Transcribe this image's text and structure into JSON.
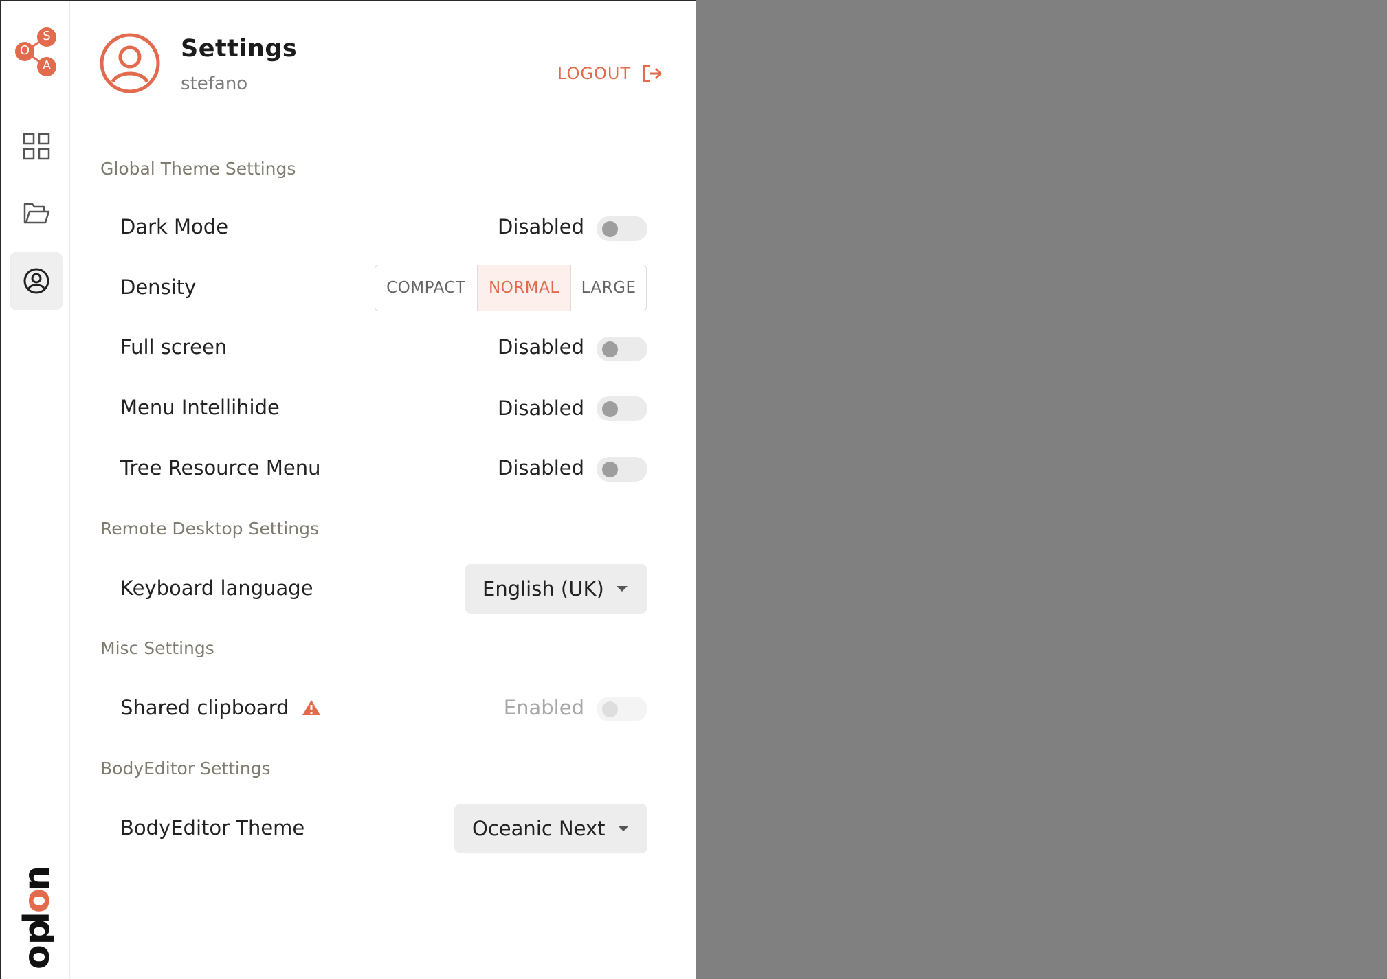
{
  "brand": {
    "logo_letters": [
      "S",
      "O",
      "A"
    ],
    "wordmark": "oplon",
    "accent_color": "#e26a4d"
  },
  "rail": {
    "items": [
      {
        "icon": "grid-icon",
        "active": false
      },
      {
        "icon": "folder-open-icon",
        "active": false
      },
      {
        "icon": "user-circle-icon",
        "active": true
      }
    ]
  },
  "header": {
    "title": "Settings",
    "username": "stefano",
    "logout_label": "LOGOUT",
    "avatar_icon": "user-circle-icon",
    "logout_icon": "logout-icon"
  },
  "sections": {
    "global_theme": {
      "title": "Global Theme Settings",
      "dark_mode": {
        "label": "Dark Mode",
        "status": "Disabled"
      },
      "density": {
        "label": "Density",
        "options": [
          "COMPACT",
          "NORMAL",
          "LARGE"
        ],
        "selected": "NORMAL"
      },
      "full_screen": {
        "label": "Full screen",
        "status": "Disabled"
      },
      "menu_intellihide": {
        "label": "Menu Intellihide",
        "status": "Disabled"
      },
      "tree_resource_menu": {
        "label": "Tree Resource Menu",
        "status": "Disabled"
      }
    },
    "remote_desktop": {
      "title": "Remote Desktop Settings",
      "keyboard_language": {
        "label": "Keyboard language",
        "value": "English (UK)"
      }
    },
    "misc": {
      "title": "Misc Settings",
      "shared_clipboard": {
        "label": "Shared clipboard",
        "status": "Enabled",
        "warning_icon": "warning-icon"
      }
    },
    "body_editor": {
      "title": "BodyEditor Settings",
      "theme": {
        "label": "BodyEditor Theme",
        "value": "Oceanic Next"
      }
    }
  }
}
